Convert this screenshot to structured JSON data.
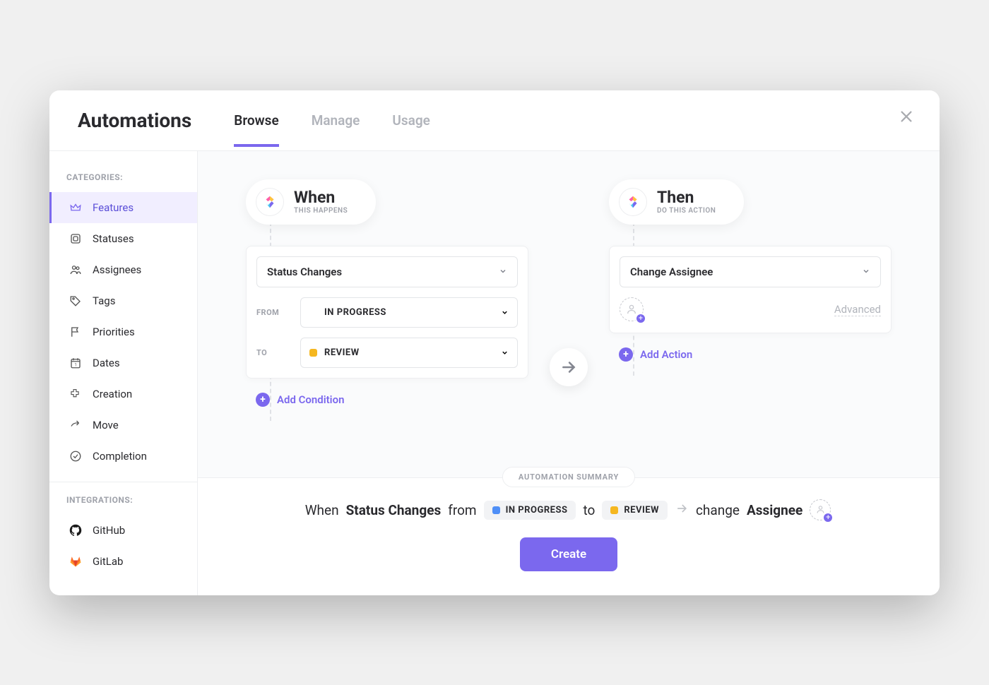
{
  "header": {
    "title": "Automations",
    "tabs": [
      {
        "id": "browse",
        "label": "Browse",
        "active": true
      },
      {
        "id": "manage",
        "label": "Manage",
        "active": false
      },
      {
        "id": "usage",
        "label": "Usage",
        "active": false
      }
    ]
  },
  "sidebar": {
    "categories_heading": "CATEGORIES:",
    "integrations_heading": "INTEGRATIONS:",
    "categories": [
      {
        "id": "features",
        "label": "Features",
        "icon": "crown",
        "active": true
      },
      {
        "id": "statuses",
        "label": "Statuses",
        "icon": "square",
        "active": false
      },
      {
        "id": "assignees",
        "label": "Assignees",
        "icon": "users",
        "active": false
      },
      {
        "id": "tags",
        "label": "Tags",
        "icon": "tag",
        "active": false
      },
      {
        "id": "priorities",
        "label": "Priorities",
        "icon": "flag",
        "active": false
      },
      {
        "id": "dates",
        "label": "Dates",
        "icon": "calendar",
        "active": false
      },
      {
        "id": "creation",
        "label": "Creation",
        "icon": "plus",
        "active": false
      },
      {
        "id": "move",
        "label": "Move",
        "icon": "share",
        "active": false
      },
      {
        "id": "completion",
        "label": "Completion",
        "icon": "check",
        "active": false
      }
    ],
    "integrations": [
      {
        "id": "github",
        "label": "GitHub",
        "icon": "github"
      },
      {
        "id": "gitlab",
        "label": "GitLab",
        "icon": "gitlab"
      }
    ]
  },
  "when": {
    "title": "When",
    "subtitle": "THIS HAPPENS",
    "trigger_label": "Status Changes",
    "from_label": "FROM",
    "to_label": "TO",
    "from_status": {
      "text": "IN PROGRESS",
      "color": "#4f8ff7"
    },
    "to_status": {
      "text": "REVIEW",
      "color": "#f5b720"
    },
    "add_condition": "Add Condition"
  },
  "then": {
    "title": "Then",
    "subtitle": "DO THIS ACTION",
    "action_label": "Change Assignee",
    "advanced": "Advanced",
    "add_action": "Add Action"
  },
  "summary": {
    "badge": "AUTOMATION SUMMARY",
    "when_word": "When",
    "trigger_bold": "Status Changes",
    "from_word": "from",
    "to_word": "to",
    "action_word": "change",
    "action_bold": "Assignee",
    "create": "Create"
  },
  "colors": {
    "accent": "#7b68ee"
  }
}
